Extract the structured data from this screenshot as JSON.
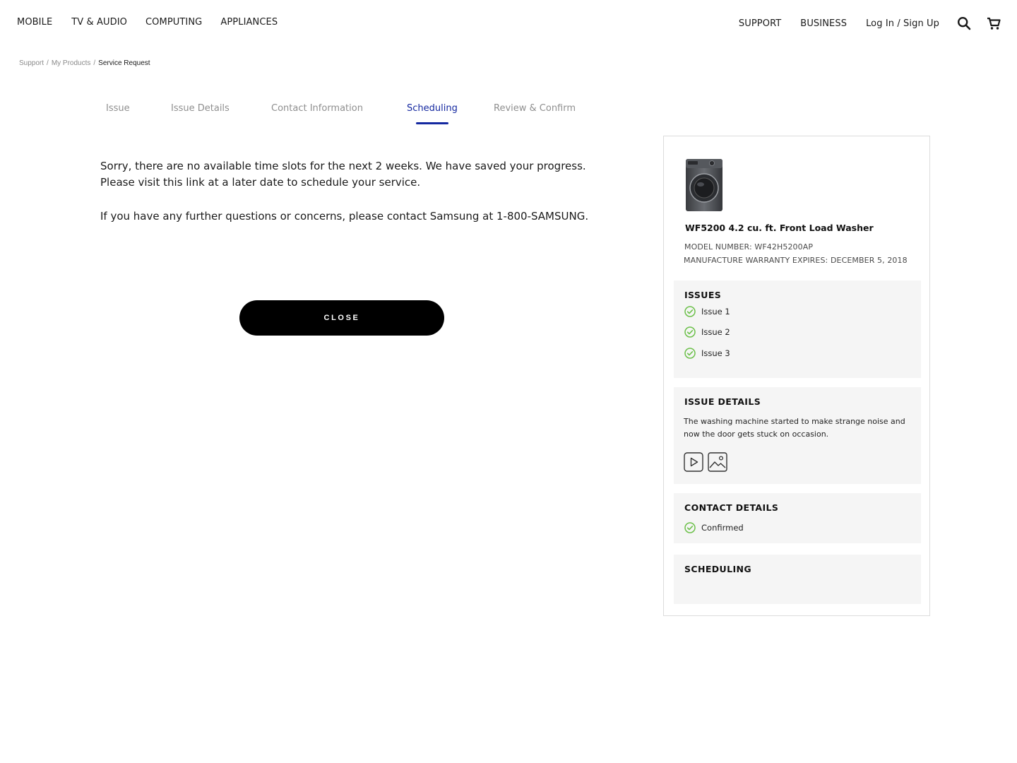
{
  "nav": {
    "left": [
      "MOBILE",
      "TV & AUDIO",
      "COMPUTING",
      "APPLIANCES"
    ],
    "support": "SUPPORT",
    "business": "BUSINESS",
    "login": "Log In / Sign Up",
    "search_icon": "search-icon",
    "cart_icon": "cart-icon"
  },
  "breadcrumb": {
    "items": [
      "Support",
      "My Products"
    ],
    "separator": "/",
    "current": "Service Request"
  },
  "steps": {
    "items": [
      "Issue",
      "Issue Details",
      "Contact Information",
      "Scheduling",
      "Review & Confirm"
    ],
    "active": "Scheduling",
    "active_color": "#1428a0"
  },
  "message": {
    "line1": "Sorry, there are no available time slots for the next 2 weeks. We have saved your progress. Please visit this link at a later date to schedule your service.",
    "line2": "If you have any further questions or concerns, please contact Samsung  at  1-800-SAMSUNG."
  },
  "close_label": "CLOSE",
  "summary": {
    "product_name": "WF5200 4.2 cu. ft. Front Load Washer",
    "model": "MODEL NUMBER: WF42H5200AP",
    "warranty": "MANUFACTURE WARRANTY EXPIRES: DECEMBER  5, 2018",
    "issues_title": "ISSUES",
    "issues": [
      "Issue 1",
      "Issue 2",
      "Issue 3"
    ],
    "details_title": "ISSUE DETAILS",
    "details_text": "The washing machine started to make strange noise and now the door gets stuck on occasion.",
    "contact_title": "CONTACT DETAILS",
    "contact_status": "Confirmed",
    "scheduling_title": "SCHEDULING",
    "check_color": "#6cc04a"
  }
}
